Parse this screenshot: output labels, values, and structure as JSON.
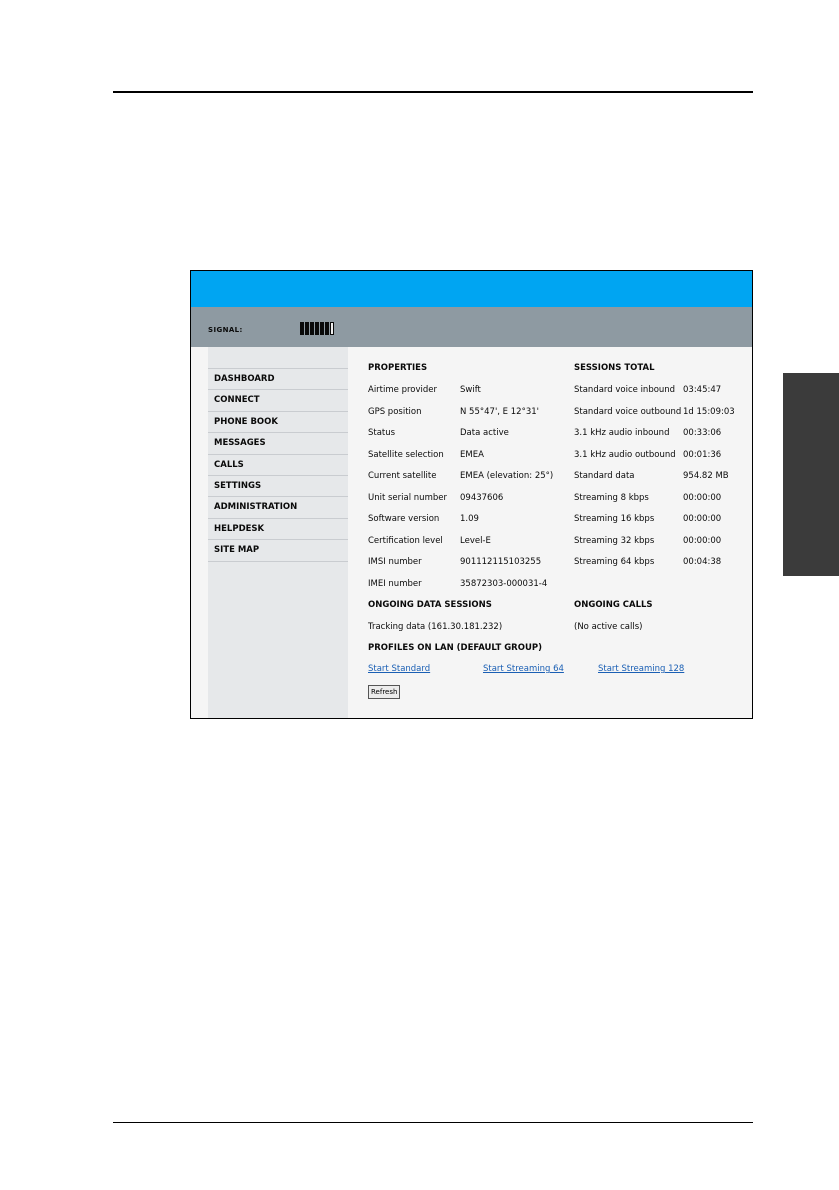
{
  "signal": {
    "label": "SIGNAL:",
    "level": 6,
    "max": 7
  },
  "nav": {
    "items": [
      "DASHBOARD",
      "CONNECT",
      "PHONE BOOK",
      "MESSAGES",
      "CALLS",
      "SETTINGS",
      "ADMINISTRATION",
      "HELPDESK",
      "SITE MAP"
    ]
  },
  "properties": {
    "title": "PROPERTIES",
    "rows": [
      {
        "label": "Airtime provider",
        "value": "Swift"
      },
      {
        "label": "GPS position",
        "value": "N 55°47', E 12°31'"
      },
      {
        "label": "Status",
        "value": "Data active"
      },
      {
        "label": "Satellite selection",
        "value": "EMEA"
      },
      {
        "label": "Current satellite",
        "value": "EMEA (elevation: 25°)"
      },
      {
        "label": "Unit serial number",
        "value": "09437606"
      },
      {
        "label": "Software version",
        "value": "1.09"
      },
      {
        "label": "Certification level",
        "value": "Level-E"
      },
      {
        "label": "IMSI number",
        "value": "901112115103255"
      },
      {
        "label": "IMEI number",
        "value": "35872303-000031-4"
      }
    ]
  },
  "sessions": {
    "title": "SESSIONS TOTAL",
    "rows": [
      {
        "label": "Standard voice inbound",
        "value": "03:45:47"
      },
      {
        "label": "Standard voice outbound",
        "value": "1d 15:09:03"
      },
      {
        "label": "3.1 kHz audio inbound",
        "value": "00:33:06"
      },
      {
        "label": "3.1 kHz audio outbound",
        "value": "00:01:36"
      },
      {
        "label": "Standard data",
        "value": "954.82 MB"
      },
      {
        "label": "Streaming 8 kbps",
        "value": "00:00:00"
      },
      {
        "label": "Streaming 16 kbps",
        "value": "00:00:00"
      },
      {
        "label": "Streaming 32 kbps",
        "value": "00:00:00"
      },
      {
        "label": "Streaming 64 kbps",
        "value": "00:04:38"
      }
    ]
  },
  "ongoing_data": {
    "title": "ONGOING DATA SESSIONS",
    "item": "Tracking data (161.30.181.232)"
  },
  "ongoing_calls": {
    "title": "ONGOING CALLS",
    "item": "(No active calls)"
  },
  "profiles": {
    "title": "PROFILES ON LAN (DEFAULT GROUP)",
    "links": [
      "Start Standard",
      "Start Streaming 64",
      "Start Streaming 128"
    ]
  },
  "refresh_label": "Refresh",
  "colors": {
    "banner": "#00a5f2",
    "signal_bar": "#8e9aa2",
    "sidebar": "#e6e8ea",
    "link": "#1a5fb4"
  }
}
